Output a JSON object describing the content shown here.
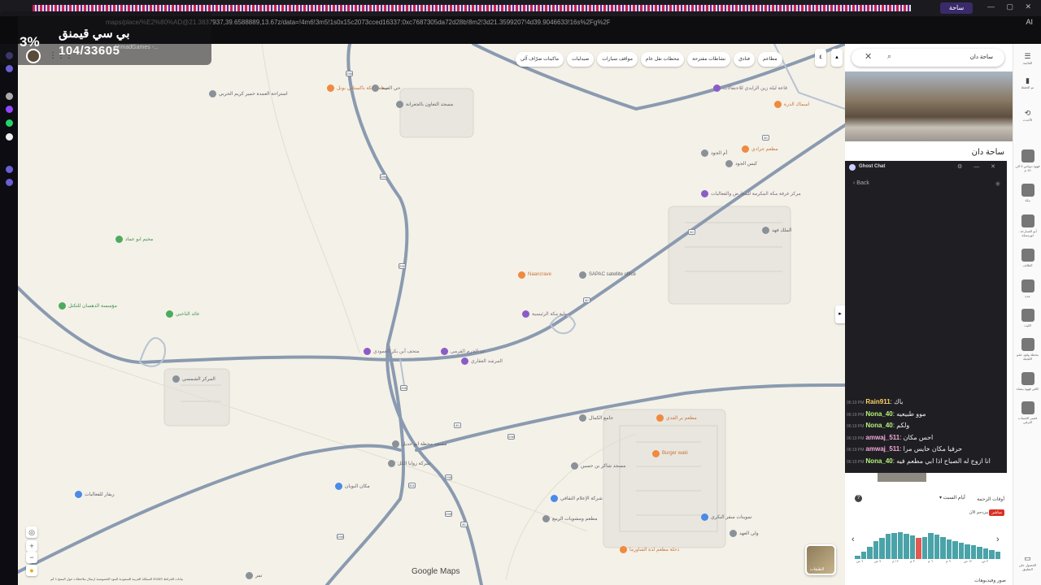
{
  "browser": {
    "active_tab_label": "ساحة",
    "url": "maps/place/%E2%80%AD@21.3837937,39.6588889,13.67z/data=!4m6!3m5!1s0x15c2073cced16337:0xc7687305da72d28b!8m2!3d21.3599207!4d39.9046633!16s%2Fg%2F11m9qqq95r",
    "right_label": "AI"
  },
  "overlay": {
    "percent": "3%",
    "title": "بي سي قيمنق",
    "count": "104/33605",
    "sub": "AhmadGames -..."
  },
  "map": {
    "chips": [
      "مطاعم",
      "فنادق",
      "نشاطات مقترحة",
      "محطات نقل عام",
      "مواقف سيارات",
      "صيدليات",
      "ماكينات صرّاف آلي"
    ],
    "more_chip": "٤",
    "places": [
      {
        "name": "استراحة العمدة خمير كريم الحربي",
        "color": "gray"
      },
      {
        "name": "مطعم مكة باكستاني بونل",
        "color": "orange"
      },
      {
        "name": "حي الغيبة",
        "color": "gray"
      },
      {
        "name": "مسجد التعاون بالجعرانة",
        "color": "gray"
      },
      {
        "name": "قاعة ليلة زين الزايدي للاحتفالات",
        "color": "purple"
      },
      {
        "name": "اسماك الدرة",
        "color": "orange"
      },
      {
        "name": "مطعم جرادي",
        "color": "orange"
      },
      {
        "name": "أم الجود",
        "color": "gray"
      },
      {
        "name": "كيس الجود",
        "color": "gray"
      },
      {
        "name": "مركز غرفة مكة المكرمة للمعارض والفعاليات",
        "color": "purple"
      },
      {
        "name": "مخيم ابو عماد",
        "color": "green"
      },
      {
        "name": "مؤسسة الدهسان للتكتل",
        "color": "green"
      },
      {
        "name": "عائد الناخبي",
        "color": "green"
      },
      {
        "name": "Naancrave",
        "color": "orange"
      },
      {
        "name": "SAPAC satellite office",
        "color": "gray"
      },
      {
        "name": "بوابة مكة الرئيسية",
        "color": "purple"
      },
      {
        "name": "متحف أبن بكر العمودي",
        "color": "purple"
      },
      {
        "name": "حد الحرم القرمي",
        "color": "purple"
      },
      {
        "name": "المرشد العقاري",
        "color": "purple"
      },
      {
        "name": "المركز الشمسي",
        "color": "gray"
      },
      {
        "name": "الملك فهد",
        "color": "gray"
      },
      {
        "name": "جامع الكمال",
        "color": "gray"
      },
      {
        "name": "مطعم بر الفدي",
        "color": "orange"
      },
      {
        "name": "شركة زوايا الكل",
        "color": "gray"
      },
      {
        "name": "مسجد محطة ابو حديل",
        "color": "gray"
      },
      {
        "name": "Burger waki",
        "color": "orange"
      },
      {
        "name": "مسجد شاكر بن حسين",
        "color": "gray"
      },
      {
        "name": "شركة الإعلام الثقافي",
        "color": "blue"
      },
      {
        "name": "مكان البوبان",
        "color": "blue"
      },
      {
        "name": "ريفار للفعاليات",
        "color": "blue"
      },
      {
        "name": "مطعم ومشويات الربيع",
        "color": "gray"
      },
      {
        "name": "تموينات سفر البكري",
        "color": "blue"
      },
      {
        "name": "ولي العهد",
        "color": "gray"
      },
      {
        "name": "دحلة مطعم لذة الشاورما",
        "color": "orange"
      },
      {
        "name": "تمر",
        "color": "gray"
      }
    ],
    "roads": [
      "298",
      "298",
      "298",
      "298",
      "80",
      "80",
      "80",
      "80",
      "298",
      "301",
      "298",
      "298",
      "298",
      "80"
    ],
    "google_logo": "Google Maps",
    "layers_label": "الطبقات",
    "footer": "بيانات الخرائط ©2026  المملكة العربية السعودية  البنود  الخصوصية  ارسال ملاحظات حول المنتج  1 كم"
  },
  "panel": {
    "search_value": "ساحة دان",
    "place_title": "ساحة دان",
    "popular_times_label": "أوقات الزحمة",
    "day_selected": "أيام السبت",
    "live_badge": "مباشر",
    "live_text": "مزدحم الآن",
    "photos_label": "صور وفيديوهات",
    "hour_labels": [
      "٦ ص",
      "٩ ص",
      "١٢ م",
      "٣ م",
      "٦ م",
      "٩ م",
      "١٢ ص",
      "٣ ص"
    ],
    "busy_levels": [
      0.1,
      0.2,
      0.35,
      0.5,
      0.6,
      0.7,
      0.72,
      0.75,
      0.7,
      0.66,
      0.6,
      0.62,
      0.72,
      0.68,
      0.62,
      0.55,
      0.5,
      0.46,
      0.42,
      0.38,
      0.35,
      0.3,
      0.26,
      0.2
    ],
    "live_index": 10
  },
  "chat": {
    "title": "Ghost Chat",
    "back_label": "Back",
    "messages": [
      {
        "time": "06:19 PM",
        "user": "Rain911",
        "color": "#ffd166",
        "text": "باك"
      },
      {
        "time": "06:19 PM",
        "user": "Nona_40",
        "color": "#b8f27a",
        "text": "موو طبيعيه"
      },
      {
        "time": "06:19 PM",
        "user": "Nona_40",
        "color": "#b8f27a",
        "text": "ولكم"
      },
      {
        "time": "06:19 PM",
        "user": "amwaj_511",
        "color": "#f3a7d9",
        "text": "احس مكان"
      },
      {
        "time": "06:19 PM",
        "user": "amwaj_511",
        "color": "#f3a7d9",
        "text": "حرفيا مكان خايس مرا"
      },
      {
        "time": "06:19 PM",
        "user": "Nona_40",
        "color": "#b8f27a",
        "text": "انا ازوج له الصباح اذا ابي مطعم فيه"
      }
    ]
  },
  "right_sidebar": {
    "items": [
      {
        "label": "القائمة"
      },
      {
        "label": "تم الحفظ"
      },
      {
        "label": "الأحدث"
      },
      {
        "label": "قهوة دوباس 9 الى 10 م"
      },
      {
        "label": "مكة"
      },
      {
        "label": "أبو الصبارعة - لوزمسلة"
      },
      {
        "label": "الطائف"
      },
      {
        "label": "جدة"
      },
      {
        "label": "الليث"
      },
      {
        "label": "محطة وقود عقم اللجيلة"
      },
      {
        "label": "كافي قهوة بيضاء"
      },
      {
        "label": "قصير الخيمات الترقي"
      },
      {
        "label": "الحصول على التطبيق"
      }
    ]
  }
}
